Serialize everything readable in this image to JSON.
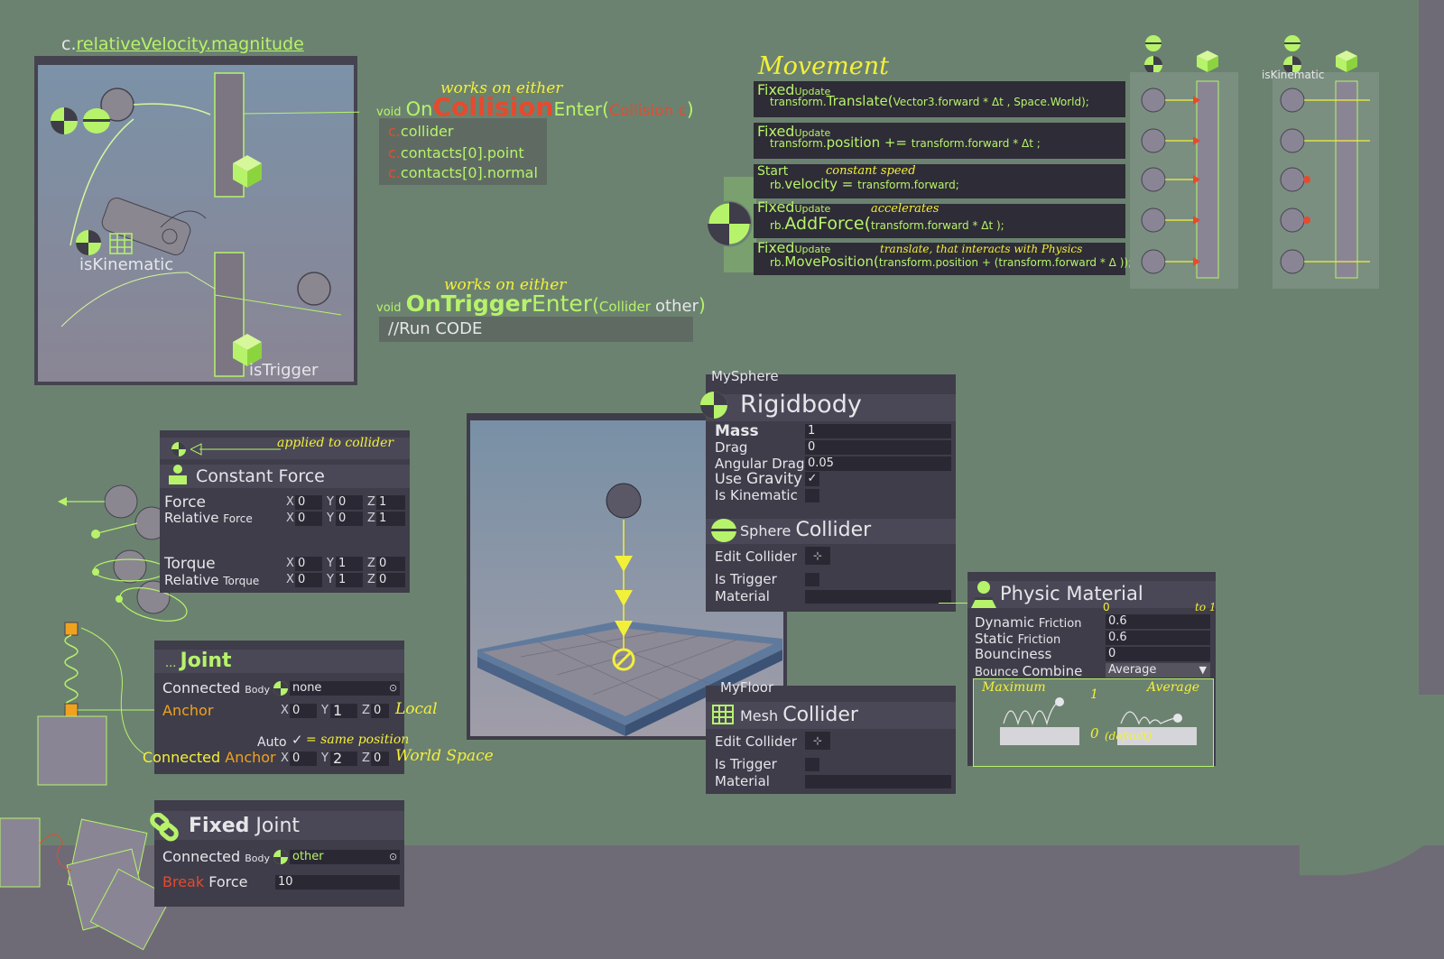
{
  "colors": {
    "bg": "#6c8270",
    "panel": "#3f3d4a",
    "green": "#b6f36a",
    "yellow": "#f3f03a",
    "orange": "#f0a21e",
    "red": "#e64a2e"
  },
  "collision": {
    "velocity_label": {
      "prefix": "c.",
      "main": "relativeVelocity.magnitude"
    },
    "iskinematic": "isKinematic",
    "istrigger": "isTrigger",
    "works_either_1": "works on either",
    "works_either_2": "works on either",
    "on_collision": {
      "void": "void",
      "on": "On",
      "collision": "Collision",
      "enter": "Enter(",
      "param": "Collision c",
      ")": ")"
    },
    "collision_lines": [
      {
        "prefix": "c.",
        "body": "collider"
      },
      {
        "prefix": "c.",
        "body": "contacts[0].point"
      },
      {
        "prefix": "c.",
        "body": "contacts[0].normal"
      }
    ],
    "on_trigger": {
      "void": "void",
      "on": "OnTrigger",
      "enter": "Enter",
      "open": "(",
      "type": "Collider",
      "param": "other",
      ")": ")"
    },
    "trigger_line": "//Run CODE"
  },
  "movement": {
    "title": "Movement",
    "rows": [
      {
        "event": "Fixed",
        "sub": "Update",
        "note": "",
        "code_prefix": "transform.",
        "code_main": "Translate(",
        "code_args": "Vector3.forward * Δt , Space.World);"
      },
      {
        "event": "Fixed",
        "sub": "Update",
        "note": "",
        "code_prefix": "transform.",
        "code_main": "position += ",
        "code_args": "transform.forward * Δt ;"
      },
      {
        "event": "Start",
        "sub": "",
        "note": "constant speed",
        "code_prefix": "rb.",
        "code_main": "velocity = ",
        "code_args": "transform.forward;"
      },
      {
        "event": "Fixed",
        "sub": "Update",
        "note": "accelerates",
        "code_prefix": "rb.",
        "code_main": "AddForce(",
        "code_args": "transform.forward * Δt );"
      },
      {
        "event": "Fixed",
        "sub": "Update",
        "note": "translate, that interacts with Physics",
        "code_prefix": "rb.",
        "code_main": "MovePosition(",
        "code_args": "transform.position + (transform.forward * Δ ));"
      }
    ],
    "iskinematic": "isKinematic"
  },
  "constant_force": {
    "applied": "applied to collider",
    "title_1": "Constant ",
    "title_2": "Force",
    "rows": [
      {
        "label": "Force",
        "sub": "",
        "x": "0",
        "y": "0",
        "z": "1"
      },
      {
        "label": "Relative ",
        "sub": "Force",
        "x": "0",
        "y": "0",
        "z": "1"
      },
      {
        "label": "Torque",
        "sub": "",
        "x": "0",
        "y": "1",
        "z": "0"
      },
      {
        "label": "Relative ",
        "sub": "Torque",
        "x": "0",
        "y": "1",
        "z": "0"
      }
    ]
  },
  "joint": {
    "title_prefix": "... ",
    "title": "Joint",
    "connected": "Connected",
    "body": "Body",
    "body_value": "none",
    "anchor": "Anchor",
    "anchor_x": "0",
    "anchor_y": "1",
    "anchor_z": "0",
    "local": "Local",
    "auto": "Auto",
    "same_position": "= same position",
    "connected_anchor_1": "Connected",
    "connected_anchor_2": " Anchor",
    "ca_x": "0",
    "ca_y": "2",
    "ca_z": "0",
    "world_space": "World Space"
  },
  "fixed_joint": {
    "title_1": "Fixed",
    "title_2": " Joint",
    "connected": "Connected",
    "body": "Body",
    "body_value": "other",
    "break_1": "Break",
    "break_2": " Force",
    "break_value": "10"
  },
  "rigidbody": {
    "object": "MySphere",
    "title": "Rigidbody",
    "mass_label": "Mass",
    "mass": "1",
    "drag_label": "Drag",
    "drag": "0",
    "angdrag_label": "Angular Drag",
    "angdrag": "0.05",
    "gravity_1": "Use ",
    "gravity_2": "Gravity",
    "kinematic_label": "Is Kinematic",
    "sphere_1": "Sphere ",
    "sphere_2": "Collider",
    "edit": "Edit Collider",
    "trigger": "Is Trigger",
    "material": "Material"
  },
  "floor": {
    "object": "MyFloor",
    "title_1": "Mesh ",
    "title_2": "Collider",
    "edit": "Edit Collider",
    "trigger": "Is Trigger",
    "material": "Material"
  },
  "physic_material": {
    "title": "Physic Material",
    "zero": "0",
    "to1": "to 1",
    "dyn_1": "Dynamic ",
    "dyn_2": "Friction",
    "dyn": "0.6",
    "stat_1": "Static ",
    "stat_2": "Friction",
    "stat": "0.6",
    "bounce": "Bounciness",
    "bounce_val": "0",
    "combine_1": "Bounce ",
    "combine_2": "Combine",
    "combine": "Average",
    "maximum": "Maximum",
    "one": "1",
    "average": "Average",
    "zero2": "0",
    "default": "(default)"
  }
}
